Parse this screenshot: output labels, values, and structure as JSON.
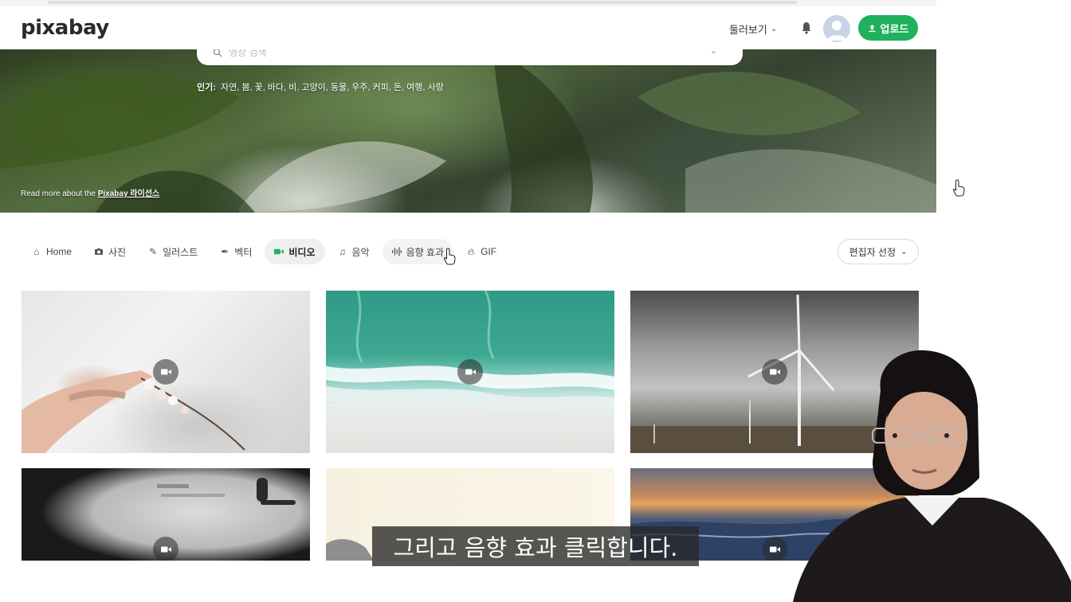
{
  "header": {
    "logo": "pixabay",
    "explore_label": "둘러보기",
    "upload_label": "업로드"
  },
  "hero": {
    "search_placeholder": "영상 검색",
    "popular_label": "인기:",
    "popular_terms": "자연, 봄, 꽃, 바다, 비, 고양이, 동물, 우주, 커피, 돈, 여행, 사랑",
    "license_prefix": "Read more about the",
    "license_link": "Pixabay 라이선스"
  },
  "categories": [
    {
      "label": "Home",
      "icon": "home-icon"
    },
    {
      "label": "사진",
      "icon": "camera-icon"
    },
    {
      "label": "일러스트",
      "icon": "brush-icon"
    },
    {
      "label": "벡터",
      "icon": "pen-nib-icon"
    },
    {
      "label": "비디오",
      "icon": "video-icon",
      "active": true
    },
    {
      "label": "음악",
      "icon": "music-note-icon"
    },
    {
      "label": "음향 효과",
      "icon": "soundwave-icon"
    },
    {
      "label": "GIF",
      "icon": "gif-icon"
    }
  ],
  "editor_select_label": "편집자 선정",
  "videos": [
    {
      "subject": "hand touching cherry blossom"
    },
    {
      "subject": "aerial ocean waves on beach"
    },
    {
      "subject": "wind turbines under stormy sky"
    },
    {
      "subject": "vinyl record turntable"
    },
    {
      "subject": "pale cream scene"
    },
    {
      "subject": "sunset over ocean"
    }
  ],
  "subtitle": "그리고 음향 효과 클릭합니다.",
  "colors": {
    "accent": "#1fb15c",
    "subtitle_bg": "#282828"
  }
}
